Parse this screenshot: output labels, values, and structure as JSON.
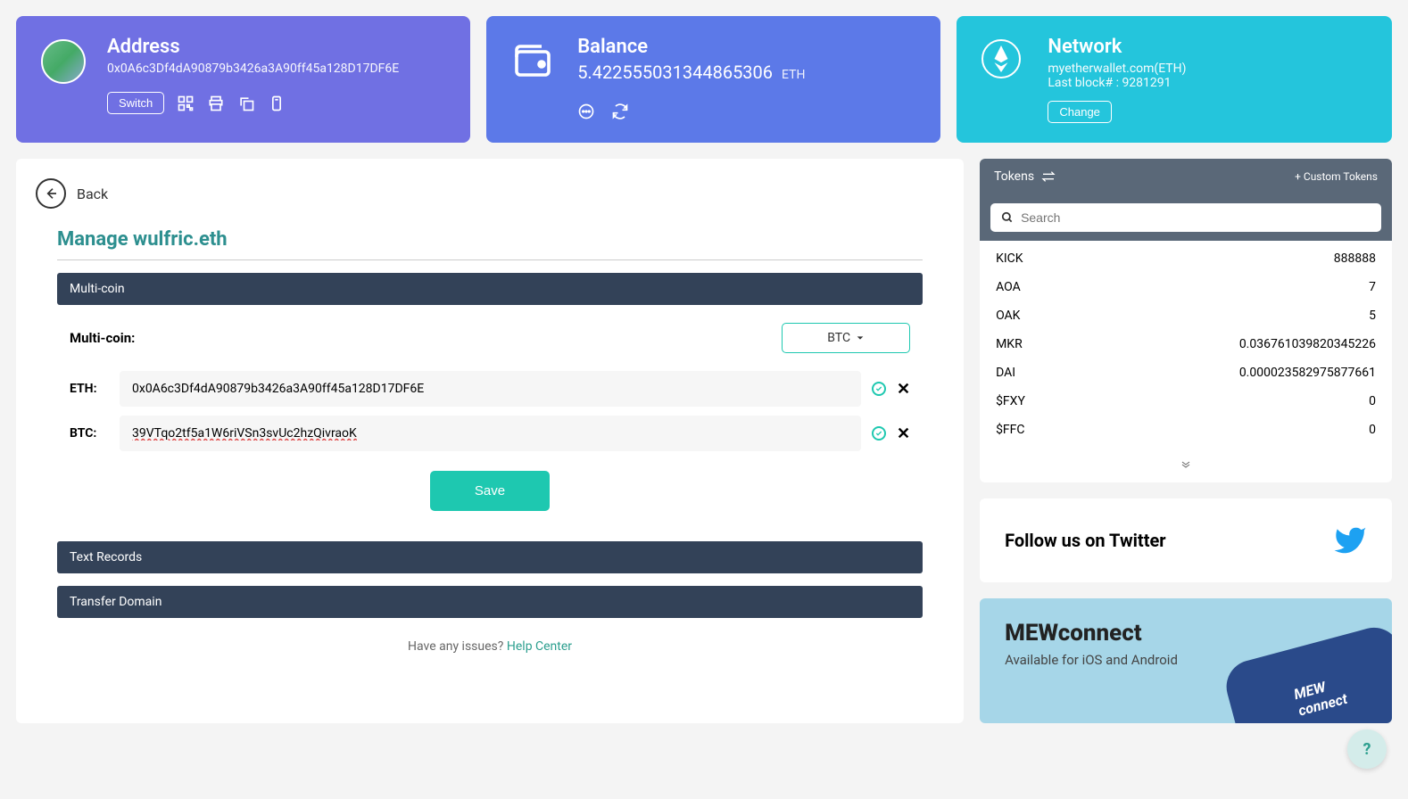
{
  "address": {
    "title": "Address",
    "value": "0x0A6c3Df4dA90879b3426a3A90ff45a128D17DF6E",
    "switch_label": "Switch"
  },
  "balance": {
    "title": "Balance",
    "value": "5.422555031344865306",
    "unit": "ETH"
  },
  "network": {
    "title": "Network",
    "provider": "myetherwallet.com(ETH)",
    "last_block_label": "Last block# : 9281291",
    "change_label": "Change"
  },
  "back_label": "Back",
  "manage_title": "Manage wulfric.eth",
  "sections": {
    "multicoin": "Multi-coin",
    "text_records": "Text Records",
    "transfer_domain": "Transfer Domain"
  },
  "multicoin": {
    "label": "Multi-coin:",
    "selected": "BTC",
    "rows": [
      {
        "coin": "ETH:",
        "value": "0x0A6c3Df4dA90879b3426a3A90ff45a128D17DF6E"
      },
      {
        "coin": "BTC:",
        "value": "39VTqo2tf5a1W6riVSn3svUc2hzQivraoK"
      }
    ],
    "save_label": "Save"
  },
  "issues": {
    "text": "Have any issues? ",
    "link": "Help Center"
  },
  "tokens": {
    "header": "Tokens",
    "custom": "+ Custom Tokens",
    "search_placeholder": "Search",
    "list": [
      {
        "sym": "KICK",
        "val": "888888"
      },
      {
        "sym": "AOA",
        "val": "7"
      },
      {
        "sym": "OAK",
        "val": "5"
      },
      {
        "sym": "MKR",
        "val": "0.036761039820345226"
      },
      {
        "sym": "DAI",
        "val": "0.000023582975877661"
      },
      {
        "sym": "$FXY",
        "val": "0"
      },
      {
        "sym": "$FFC",
        "val": "0"
      }
    ]
  },
  "twitter": {
    "text": "Follow us on Twitter"
  },
  "mew": {
    "title": "MEWconnect",
    "sub": "Available for iOS and Android"
  },
  "help": "?"
}
